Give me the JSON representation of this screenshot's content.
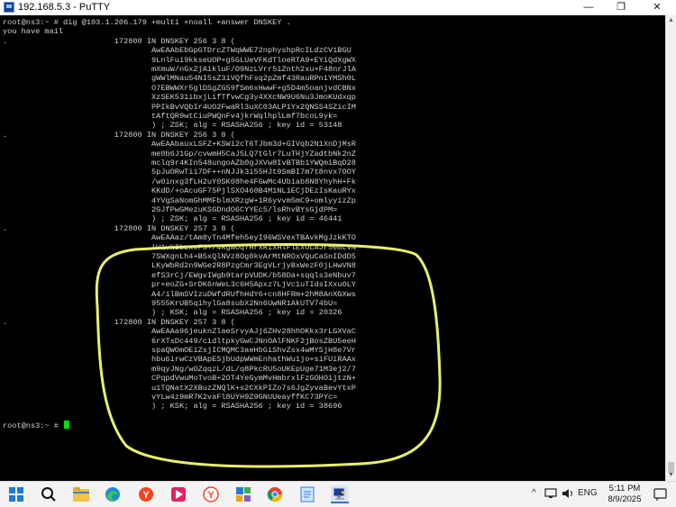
{
  "window": {
    "title": "192.168.5.3 - PuTTY",
    "min_glyph": "—",
    "max_glyph": "❐",
    "close_glyph": "✕"
  },
  "terminal": {
    "lines": [
      "root@ns3:~ # dig @103.1.206.179 +multi +noall +answer DNSKEY .",
      "you have mail",
      ".                       172800 IN DNSKEY 256 3 8 (",
      "                                AwEAAbEbGpGTDrcZTWqWWE72nphyshpRcILdzCV1BGU",
      "                                9LnlFui9kkseUOP+g5GLUeVFKdTloeRTA9+EYiQdXgWX",
      "                                mXmuW/nGxZjAikluF/O9NzLVrr5iZnth2xu+F48nrJlA",
      "                                gWWlMNau54NI5sZ3iVQfhFsq2pZmf43RauRPniYMSh0L",
      "                                O7EBWWXr5glDSgZG59fSm6xHwwF+g5D4m5oanjvdCBNx",
      "                                XzSEK531ibxjLifTfvwCg3y4XXcNW9U6Nu3JmoKUdxqp",
      "                                PPIkBvVQbIr4UO2FwaRl3uXC03ALP1Yx2QNSS4SZicIM",
      "                                tAftQR9wtCiuPWQnFv4jkrWqlhplLmf7bcoL9yk=",
      "                                ) ; ZSK; alg = RSASHA256 ; key id = 53148",
      ".                       172800 IN DNSKEY 256 3 8 (",
      "                                AwEAAbauxLSFZ+KSWi2cT6TJbm3d+GIVqb2N1XnDjMsR",
      "                                me0b6J1Gp/cvwmH5CaJ5LQ7tGlr7LuTHjYZadtbNk2nZ",
      "                                mclq9r4KIn548ungoAZb0gJXVw8IvBTBb1YWQmiBqD28",
      "                                5pJuORwTii7DF++nNJJk3i55HJt9SmBI7m7t8nvx7OOY",
      "                                /w0inxg3fLH2uY0SK08he4FGwMc4Ubiab8N8YhyhH+Fk",
      "                                KKdD/+oAcuGF75PjlSXO460B4M1NL1ECjDEzIsKauRYx",
      "                                4YVgSaNomGhMMFblmXRzgW+1R6yvvm5mC9+omlyyizZp",
      "                                2GJfPwGMezuKSGDndO6CYYEc5/lsRhvBYsGjdPM=",
      "                                ) ; ZSK; alg = RSASHA256 ; key id = 46441",
      ".                       172800 IN DNSKEY 257 3 8 (",
      "                                AwEAAaz/tAm8yTn4Mfeh5eyI96WSVexTBAvkMgJzkKTO",
      "                                iW1vkIbzxeF3+/4RgWOq7HrxRixHlFlExOLAJr5emLvN",
      "                                7SWXgnLh4+B5xQlNVz8Og8kvArMtNROxVQuCaSnIDdD5",
      "                                LKyWbRd2n9WGe2R8PzgCmr3EgVLrjyBxWezF0jLHwVN8",
      "                                efS3rCj/EWgvIWgb9tarpVUDK/b58Da+sqqls3eNbuv7",
      "                                pr+eoZG+SrDK6nWeL3c6H5Apxz7LjVc1uTIdsIXxuOLY",
      "                                A4/ilBmSVIzuDWfdRUfhHdY6+cn8HFRm+2hM8AnXGXws",
      "                                9555KrUB5qihylGa8subX2Nn6UwNR1AkUTV74bU=",
      "                                ) ; KSK; alg = RSASHA256 ; key id = 20326",
      ".                       172800 IN DNSKEY 257 3 8 (",
      "                                AwEAAa96jeuknZlaeSrvyAJj6ZHv28hhOKkx3rLGXVaC",
      "                                6rXTsDc449/cidltpkyGwCJNnOAlFNKF2jBosZBU5eeH",
      "                                spaQWOmOEiZsjICMQMC3aeHbGiShvZsx4wMYSjH8e7Vr",
      "                                hbu6irwCzVBApESjbUdpWWmEnhathWu1jo+siFUiRAAx",
      "                                m9qyJNg/wOZqqzL/dL/q8PkcRU5oUKEpUge71M3ej2/7",
      "                                CPqpdVwuMoTvoB+2OT4YeGymMvHmbrxlFzGOHOijtzN+",
      "                                u1TQNatX2XBuzZNQlK+s2CXkPIZo7s6JgZyvaBevYtxP",
      "                                vYLw4z9mR7K2vaFl8UYH9Z9GNUUeayffKC73PYc=",
      "                                ) ; KSK; alg = RSASHA256 ; key id = 38696",
      "",
      "root@ns3:~ # "
    ]
  },
  "colors": {
    "terminal_bg": "#000000",
    "terminal_fg": "#d0d0d0",
    "cursor": "#00e000",
    "highlight": "#e8f06a"
  },
  "taskbar": {
    "icons": [
      "windows-start-icon",
      "search-icon",
      "file-explorer-icon",
      "edge-browser-icon",
      "yandex-browser-icon",
      "media-player-icon",
      "yandex-browser-icon",
      "task-switcher-icon",
      "chrome-icon",
      "notepad-icon",
      "putty-icon"
    ],
    "tray_chevron": "^",
    "language": "ENG",
    "time": "5:11 PM",
    "date": "8/9/2025"
  }
}
